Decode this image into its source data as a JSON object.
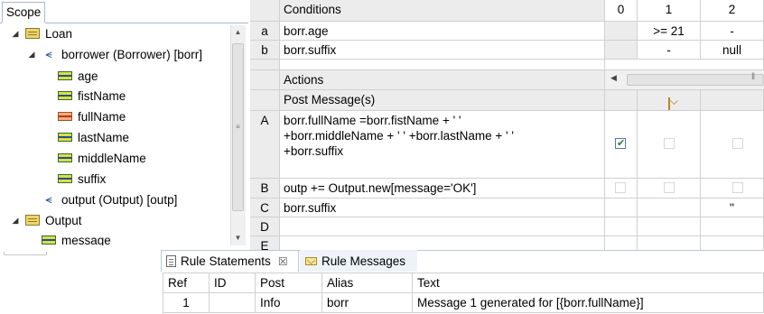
{
  "scope": {
    "tab_label": "Scope",
    "tree": [
      {
        "label": "Loan",
        "icon": "entity-icon",
        "twisty": "◢"
      },
      {
        "label": "borrower (Borrower) [borr]",
        "icon": "association-icon",
        "twisty": "◢"
      },
      {
        "label": "age",
        "icon": "attribute-icon"
      },
      {
        "label": "fistName",
        "icon": "attribute-icon"
      },
      {
        "label": "fullName",
        "icon": "derived-attribute-icon"
      },
      {
        "label": "lastName",
        "icon": "attribute-icon"
      },
      {
        "label": "middleName",
        "icon": "attribute-icon"
      },
      {
        "label": "suffix",
        "icon": "attribute-icon"
      },
      {
        "label": "output (Output) [outp]",
        "icon": "association-icon"
      },
      {
        "label": "Output",
        "icon": "entity-icon",
        "twisty": "◢"
      },
      {
        "label": "message",
        "icon": "attribute-icon"
      }
    ]
  },
  "decision_table": {
    "conditions_header": "Conditions",
    "column_headers": [
      "0",
      "1",
      "2"
    ],
    "conditions": [
      {
        "id": "a",
        "text": "borr.age",
        "values": [
          "",
          ">= 21",
          "-"
        ]
      },
      {
        "id": "b",
        "text": "borr.suffix",
        "values": [
          "",
          "-",
          "null"
        ]
      }
    ],
    "actions_header": "Actions",
    "post_message_label": "Post Message(s)",
    "actions": [
      {
        "id": "A",
        "lines": [
          "borr.fullName =borr.fistName + ' '",
          "+borr.middleName + ' ' +borr.lastName + ' '",
          "+borr.suffix"
        ]
      },
      {
        "id": "B",
        "lines": [
          "outp += Output.new[message='OK']"
        ]
      },
      {
        "id": "C",
        "lines": [
          "borr.suffix"
        ],
        "col2_value": "''"
      },
      {
        "id": "D",
        "lines": [
          ""
        ]
      },
      {
        "id": "E",
        "lines": [
          ""
        ]
      }
    ]
  },
  "bottom": {
    "tabs": [
      {
        "label": "Rule Statements",
        "close": "☒"
      },
      {
        "label": "Rule Messages"
      }
    ],
    "grid": {
      "headers": [
        "Ref",
        "ID",
        "Post",
        "Alias",
        "Text"
      ],
      "rows": [
        {
          "ref": "1",
          "id": "",
          "post": "Info",
          "alias": "borr",
          "text": "Message 1 generated for [{borr.fullName}]"
        }
      ]
    }
  }
}
